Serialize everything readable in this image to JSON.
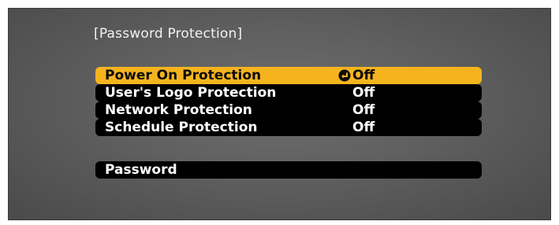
{
  "screen": {
    "title": "[Password Protection]"
  },
  "options": [
    {
      "label": "Power On Protection",
      "value": "Off"
    },
    {
      "label": "User's Logo Protection",
      "value": "Off"
    },
    {
      "label": "Network Protection",
      "value": "Off"
    },
    {
      "label": "Schedule Protection",
      "value": "Off"
    }
  ],
  "password": {
    "label": "Password"
  },
  "colors": {
    "highlight": "#f5b41e",
    "row_background": "#000000",
    "screen_background": "#606060"
  },
  "icons": {
    "selected_marker": "enter-arrow-icon"
  }
}
